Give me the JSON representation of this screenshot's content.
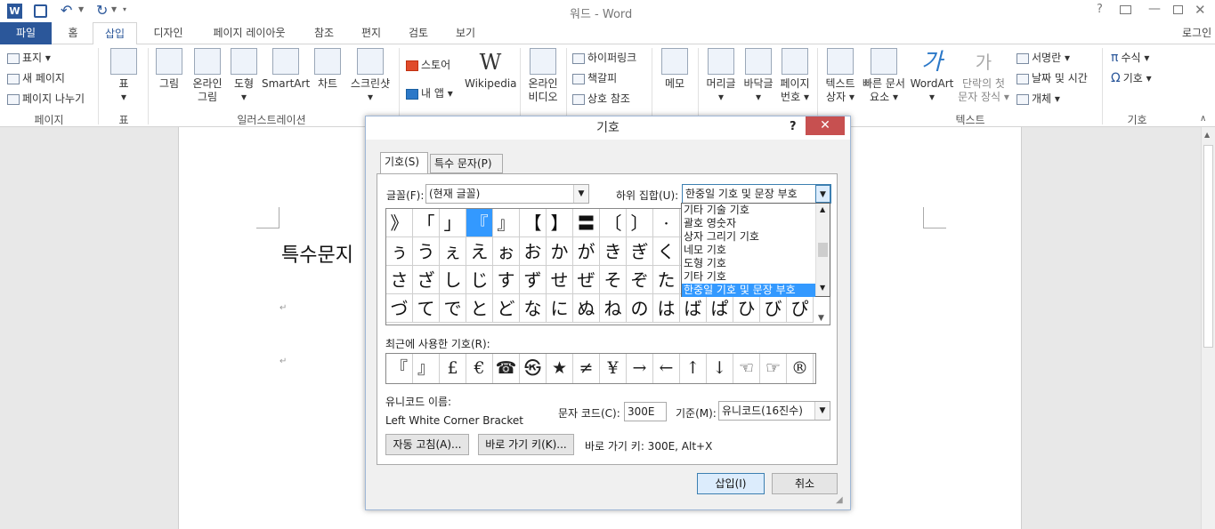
{
  "window": {
    "title": "워드 - Word",
    "login": "로그인"
  },
  "ribbon_tabs": [
    "파일",
    "홈",
    "삽입",
    "디자인",
    "페이지 레이아웃",
    "참조",
    "편지",
    "검토",
    "보기"
  ],
  "ribbon": {
    "pages": {
      "cover": "표지",
      "new_page": "새 페이지",
      "page_break": "페이지 나누기",
      "group": "페이지"
    },
    "table": {
      "label": "표",
      "group": "표"
    },
    "illustrations": {
      "picture": "그림",
      "online_picture_1": "온라인",
      "online_picture_2": "그림",
      "shapes": "도형",
      "smartart": "SmartArt",
      "chart": "차트",
      "screenshot": "스크린샷",
      "group": "일러스트레이션"
    },
    "apps": {
      "store": "스토어",
      "my_apps": "내 앱",
      "wikipedia": "Wikipedia"
    },
    "media": {
      "online_video_1": "온라인",
      "online_video_2": "비디오"
    },
    "links": {
      "hyperlink": "하이퍼링크",
      "bookmark": "책갈피",
      "cross_ref": "상호 참조"
    },
    "comments": {
      "comment": "메모"
    },
    "header_footer": {
      "header": "머리글",
      "footer": "바닥글",
      "page_number_1": "페이지",
      "page_number_2": "번호"
    },
    "text": {
      "textbox_1": "텍스트",
      "textbox_2": "상자",
      "quickparts_1": "빠른 문서",
      "quickparts_2": "요소",
      "wordart": "WordArt",
      "dropcap_1": "단락의 첫",
      "dropcap_2": "문자 장식",
      "signature": "서명란",
      "datetime": "날짜 및 시간",
      "object": "개체",
      "group": "텍스트"
    },
    "symbols": {
      "equation": "수식",
      "symbol": "기호",
      "group": "기호"
    }
  },
  "document": {
    "heading": "특수문지"
  },
  "dialog": {
    "title": "기호",
    "help": "?",
    "tabs": [
      "기호(S)",
      "특수 문자(P)"
    ],
    "font_label": "글꼴(F):",
    "font_value": "(현재 글꼴)",
    "subset_label": "하위 집합(U):",
    "subset_value": "한중일 기호 및 문장 부호",
    "subset_options": [
      "기타 기술 기호",
      "괄호 영숫자",
      "상자 그리기 기호",
      "네모 기호",
      "도형 기호",
      "기타 기호",
      "한중일 기호 및 문장 부호"
    ],
    "symbol_rows": [
      [
        "》",
        "「",
        "」",
        "『",
        "』",
        "【",
        "】",
        "〓",
        "〔",
        "〕",
        "·",
        "",
        "",
        ""
      ],
      [
        "ぅ",
        "う",
        "ぇ",
        "え",
        "ぉ",
        "お",
        "か",
        "が",
        "き",
        "ぎ",
        "く",
        "",
        "",
        ""
      ],
      [
        "さ",
        "ざ",
        "し",
        "じ",
        "す",
        "ず",
        "せ",
        "ぜ",
        "そ",
        "ぞ",
        "た",
        "",
        "",
        ""
      ],
      [
        "づ",
        "て",
        "で",
        "と",
        "ど",
        "な",
        "に",
        "ぬ",
        "ね",
        "の",
        "は",
        "ば",
        "ぱ",
        "ひ",
        "び",
        "ぴ"
      ]
    ],
    "selected_symbol": "『",
    "recent_label": "최근에 사용한 기호(R):",
    "recent_symbols": [
      "『",
      "』",
      "£",
      "€",
      "☎",
      "㉿",
      "★",
      "≠",
      "¥",
      "→",
      "←",
      "↑",
      "↓",
      "☜",
      "☞",
      "®"
    ],
    "unicode_name_label": "유니코드 이름:",
    "unicode_name": "Left White Corner Bracket",
    "char_code_label": "문자 코드(C):",
    "char_code": "300E",
    "from_label": "기준(M):",
    "from_value": "유니코드(16진수)",
    "autocorrect": "자동 고침(A)...",
    "shortcut_key": "바로 가기 키(K)...",
    "shortcut_text": "바로 가기 키: 300E, Alt+X",
    "insert": "삽입(I)",
    "cancel": "취소"
  },
  "colors": {
    "accent": "#2b579a",
    "selection": "#3399ff",
    "close": "#c75050"
  }
}
